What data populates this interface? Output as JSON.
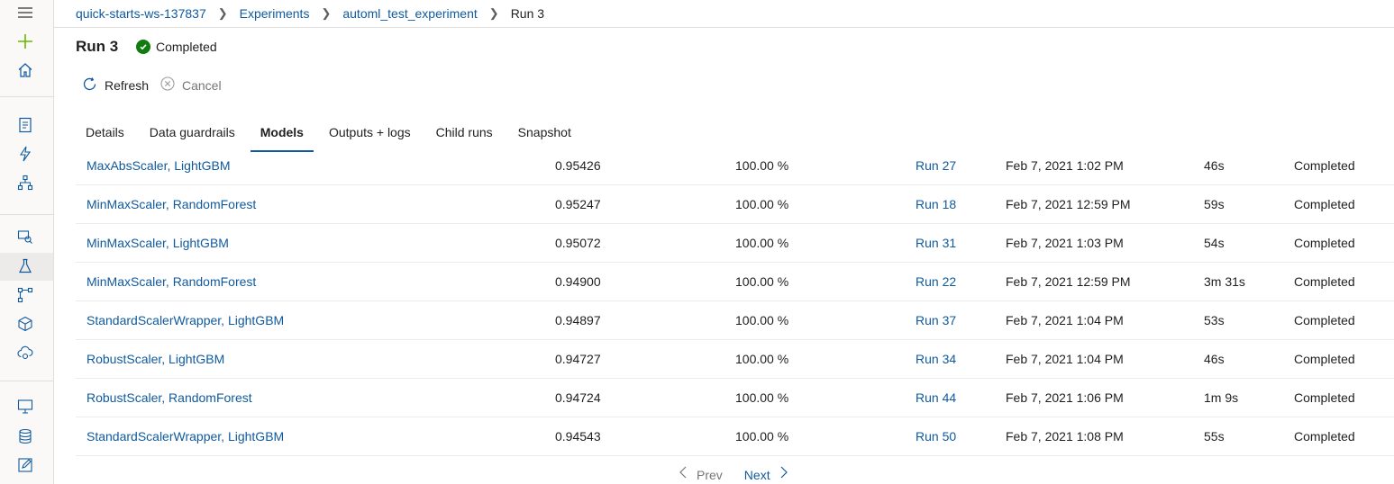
{
  "nav": {
    "icons": [
      "hamburger-icon",
      "plus-icon",
      "home-icon",
      "notebook-icon",
      "automl-icon",
      "designer-icon",
      "datasets-icon",
      "experiments-icon",
      "pipelines-icon",
      "models-icon",
      "endpoints-icon",
      "compute-icon",
      "datastores-icon",
      "labeling-icon"
    ]
  },
  "breadcrumb": {
    "items": [
      "quick-starts-ws-137837",
      "Experiments",
      "automl_test_experiment"
    ],
    "current": "Run 3"
  },
  "header": {
    "title": "Run 3",
    "status": "Completed"
  },
  "commands": {
    "refresh": "Refresh",
    "cancel": "Cancel"
  },
  "tabs": [
    "Details",
    "Data guardrails",
    "Models",
    "Outputs + logs",
    "Child runs",
    "Snapshot"
  ],
  "selected_tab": "Models",
  "models": [
    {
      "name": "MaxAbsScaler, LightGBM",
      "metric": "0.95426",
      "sampling": "100.00 %",
      "run": "Run 27",
      "created": "Feb 7, 2021 1:02 PM",
      "duration": "46s",
      "status": "Completed"
    },
    {
      "name": "MinMaxScaler, RandomForest",
      "metric": "0.95247",
      "sampling": "100.00 %",
      "run": "Run 18",
      "created": "Feb 7, 2021 12:59 PM",
      "duration": "59s",
      "status": "Completed"
    },
    {
      "name": "MinMaxScaler, LightGBM",
      "metric": "0.95072",
      "sampling": "100.00 %",
      "run": "Run 31",
      "created": "Feb 7, 2021 1:03 PM",
      "duration": "54s",
      "status": "Completed"
    },
    {
      "name": "MinMaxScaler, RandomForest",
      "metric": "0.94900",
      "sampling": "100.00 %",
      "run": "Run 22",
      "created": "Feb 7, 2021 12:59 PM",
      "duration": "3m 31s",
      "status": "Completed"
    },
    {
      "name": "StandardScalerWrapper, LightGBM",
      "metric": "0.94897",
      "sampling": "100.00 %",
      "run": "Run 37",
      "created": "Feb 7, 2021 1:04 PM",
      "duration": "53s",
      "status": "Completed"
    },
    {
      "name": "RobustScaler, LightGBM",
      "metric": "0.94727",
      "sampling": "100.00 %",
      "run": "Run 34",
      "created": "Feb 7, 2021 1:04 PM",
      "duration": "46s",
      "status": "Completed"
    },
    {
      "name": "RobustScaler, RandomForest",
      "metric": "0.94724",
      "sampling": "100.00 %",
      "run": "Run 44",
      "created": "Feb 7, 2021 1:06 PM",
      "duration": "1m 9s",
      "status": "Completed"
    },
    {
      "name": "StandardScalerWrapper, LightGBM",
      "metric": "0.94543",
      "sampling": "100.00 %",
      "run": "Run 50",
      "created": "Feb 7, 2021 1:08 PM",
      "duration": "55s",
      "status": "Completed"
    }
  ],
  "pager": {
    "prev": "Prev",
    "next": "Next"
  },
  "colors": {
    "link": "#0f5a9e",
    "success": "#107c10",
    "accent_green": "#6bb700"
  }
}
